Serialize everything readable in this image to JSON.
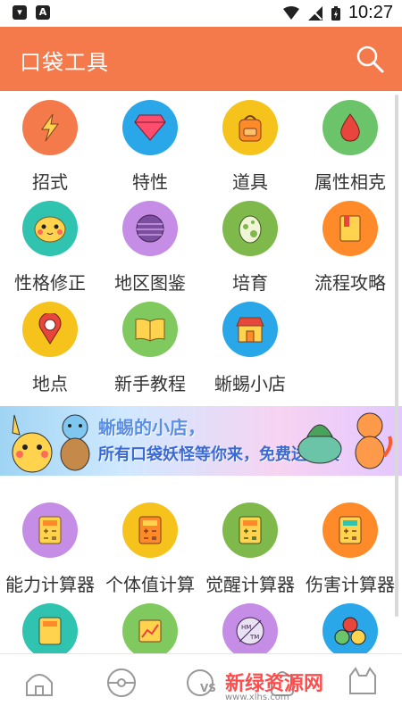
{
  "status": {
    "time": "10:27"
  },
  "appbar": {
    "title": "口袋工具"
  },
  "menu": {
    "row1": [
      {
        "label": "招式",
        "color": "#f47a4c",
        "icon": "lightning-icon"
      },
      {
        "label": "特性",
        "color": "#2aa7e8",
        "icon": "gem-icon"
      },
      {
        "label": "道具",
        "color": "#f6c21c",
        "icon": "backpack-icon"
      },
      {
        "label": "属性相克",
        "color": "#6cc46a",
        "icon": "flame-drop-icon"
      }
    ],
    "row2": [
      {
        "label": "性格修正",
        "color": "#30c3b0",
        "icon": "pikachu-face-icon"
      },
      {
        "label": "地区图鉴",
        "color": "#c58de6",
        "icon": "planet-icon"
      },
      {
        "label": "培育",
        "color": "#7fb84b",
        "icon": "egg-icon"
      },
      {
        "label": "流程攻略",
        "color": "#ff8a2a",
        "icon": "book-icon"
      }
    ],
    "row3": [
      {
        "label": "地点",
        "color": "#f6c21c",
        "icon": "map-pin-icon"
      },
      {
        "label": "新手教程",
        "color": "#7fc95f",
        "icon": "open-book-icon"
      },
      {
        "label": "蜥蜴小店",
        "color": "#2aa7e8",
        "icon": "shop-icon"
      }
    ],
    "row4": [
      {
        "label": "能力计算器",
        "color": "#c58de6",
        "icon": "calculator-icon"
      },
      {
        "label": "个体值计算",
        "color": "#f6c21c",
        "icon": "calculator-icon"
      },
      {
        "label": "觉醒计算器",
        "color": "#7fb84b",
        "icon": "calculator-icon"
      },
      {
        "label": "伤害计算器",
        "color": "#ff8a2a",
        "icon": "calculator-icon"
      }
    ],
    "row5": [
      {
        "label": "",
        "color": "#30c3b0",
        "icon": "calculator-icon"
      },
      {
        "label": "",
        "color": "#7fc95f",
        "icon": "chart-icon"
      },
      {
        "label": "",
        "color": "#c58de6",
        "icon": "hm-tm-icon"
      },
      {
        "label": "",
        "color": "#2aa7e8",
        "icon": "three-dots-icon"
      }
    ]
  },
  "banner": {
    "line1": "蜥蜴的小店，",
    "line2": "所有口袋妖怪等你来，免费送道具"
  },
  "watermark": {
    "text": "新绿资源网",
    "sub": "www.xlhs.com"
  }
}
